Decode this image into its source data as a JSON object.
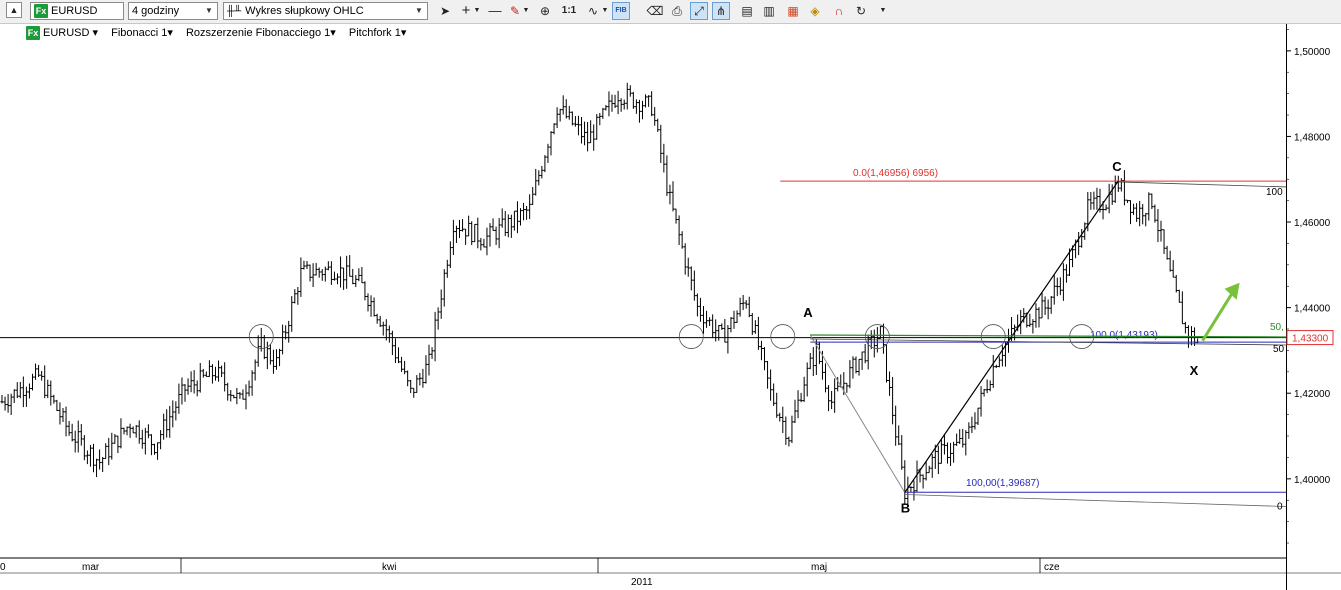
{
  "toolbar": {
    "symbol": "EURUSD",
    "timeframe": "4 godziny",
    "chart_style": "Wykres słupkowy OHLC",
    "one_to_one_label": "1:1",
    "fib_label": "FIB"
  },
  "legend": {
    "symbol": "EURUSD",
    "studies": [
      "Fibonacci 1",
      "Rozszerzenie Fibonacciego 1",
      "Pitchfork 1"
    ]
  },
  "annotations": {
    "fib_top": "0.0(1,46956) 6956)",
    "fib_mid": "100.0(1,43193)",
    "fib_bottom": "100,00(1,39687)",
    "label_a": "A",
    "label_b": "B",
    "label_c": "C",
    "label_x": "X",
    "pitch_100": "100",
    "pitch_50": "50",
    "pitch_50_green": "50,",
    "pitch_0": "0"
  },
  "colors": {
    "fib_red": "#e03030",
    "fib_blue": "#2a2ab8",
    "pitch_green": "#2e8b2e",
    "arrow_green": "#78c23a",
    "price_tag_red": "#e03030"
  },
  "chart_data": {
    "type": "ohlc",
    "symbol": "EURUSD",
    "timeframe": "4 godziny",
    "current_price": "1,43300",
    "y_ticks": [
      "1,50000",
      "1,48000",
      "1,46000",
      "1,44000",
      "1,42000",
      "1,40000"
    ],
    "ylim": [
      1.3815,
      1.5065
    ],
    "x_labels": [
      "mar",
      "kwi",
      "maj",
      "cze"
    ],
    "year_label": "2011",
    "support_level": 1.433,
    "fibonacci_levels": {
      "top": 1.46956,
      "mid": 1.43193,
      "bottom": 1.39687
    },
    "pattern_points": {
      "A": {
        "bar": 265,
        "price": 1.4336
      },
      "B": {
        "bar": 296,
        "price": 1.3968
      },
      "C": {
        "bar": 366,
        "price": 1.4696
      },
      "X": {
        "bar": 392,
        "price": 1.4318
      }
    },
    "price_path": [
      [
        0,
        1.418
      ],
      [
        12,
        1.424
      ],
      [
        22,
        1.411
      ],
      [
        32,
        1.404
      ],
      [
        42,
        1.413
      ],
      [
        50,
        1.408
      ],
      [
        60,
        1.421
      ],
      [
        70,
        1.425
      ],
      [
        78,
        1.418
      ],
      [
        85,
        1.431
      ],
      [
        90,
        1.427
      ],
      [
        98,
        1.448
      ],
      [
        110,
        1.449
      ],
      [
        118,
        1.445
      ],
      [
        126,
        1.435
      ],
      [
        134,
        1.42
      ],
      [
        140,
        1.427
      ],
      [
        148,
        1.46
      ],
      [
        158,
        1.456
      ],
      [
        165,
        1.459
      ],
      [
        173,
        1.463
      ],
      [
        182,
        1.487
      ],
      [
        192,
        1.479
      ],
      [
        202,
        1.49
      ],
      [
        213,
        1.487
      ],
      [
        219,
        1.465
      ],
      [
        228,
        1.44
      ],
      [
        236,
        1.433
      ],
      [
        244,
        1.442
      ],
      [
        252,
        1.42
      ],
      [
        258,
        1.41
      ],
      [
        263,
        1.423
      ],
      [
        267,
        1.43
      ],
      [
        272,
        1.418
      ],
      [
        280,
        1.427
      ],
      [
        288,
        1.434
      ],
      [
        296,
        1.397
      ],
      [
        306,
        1.405
      ],
      [
        316,
        1.409
      ],
      [
        326,
        1.428
      ],
      [
        334,
        1.437
      ],
      [
        342,
        1.44
      ],
      [
        350,
        1.45
      ],
      [
        356,
        1.463
      ],
      [
        362,
        1.465
      ],
      [
        366,
        1.469
      ],
      [
        372,
        1.462
      ],
      [
        377,
        1.465
      ],
      [
        382,
        1.45
      ],
      [
        388,
        1.435
      ],
      [
        392,
        1.432
      ]
    ]
  }
}
